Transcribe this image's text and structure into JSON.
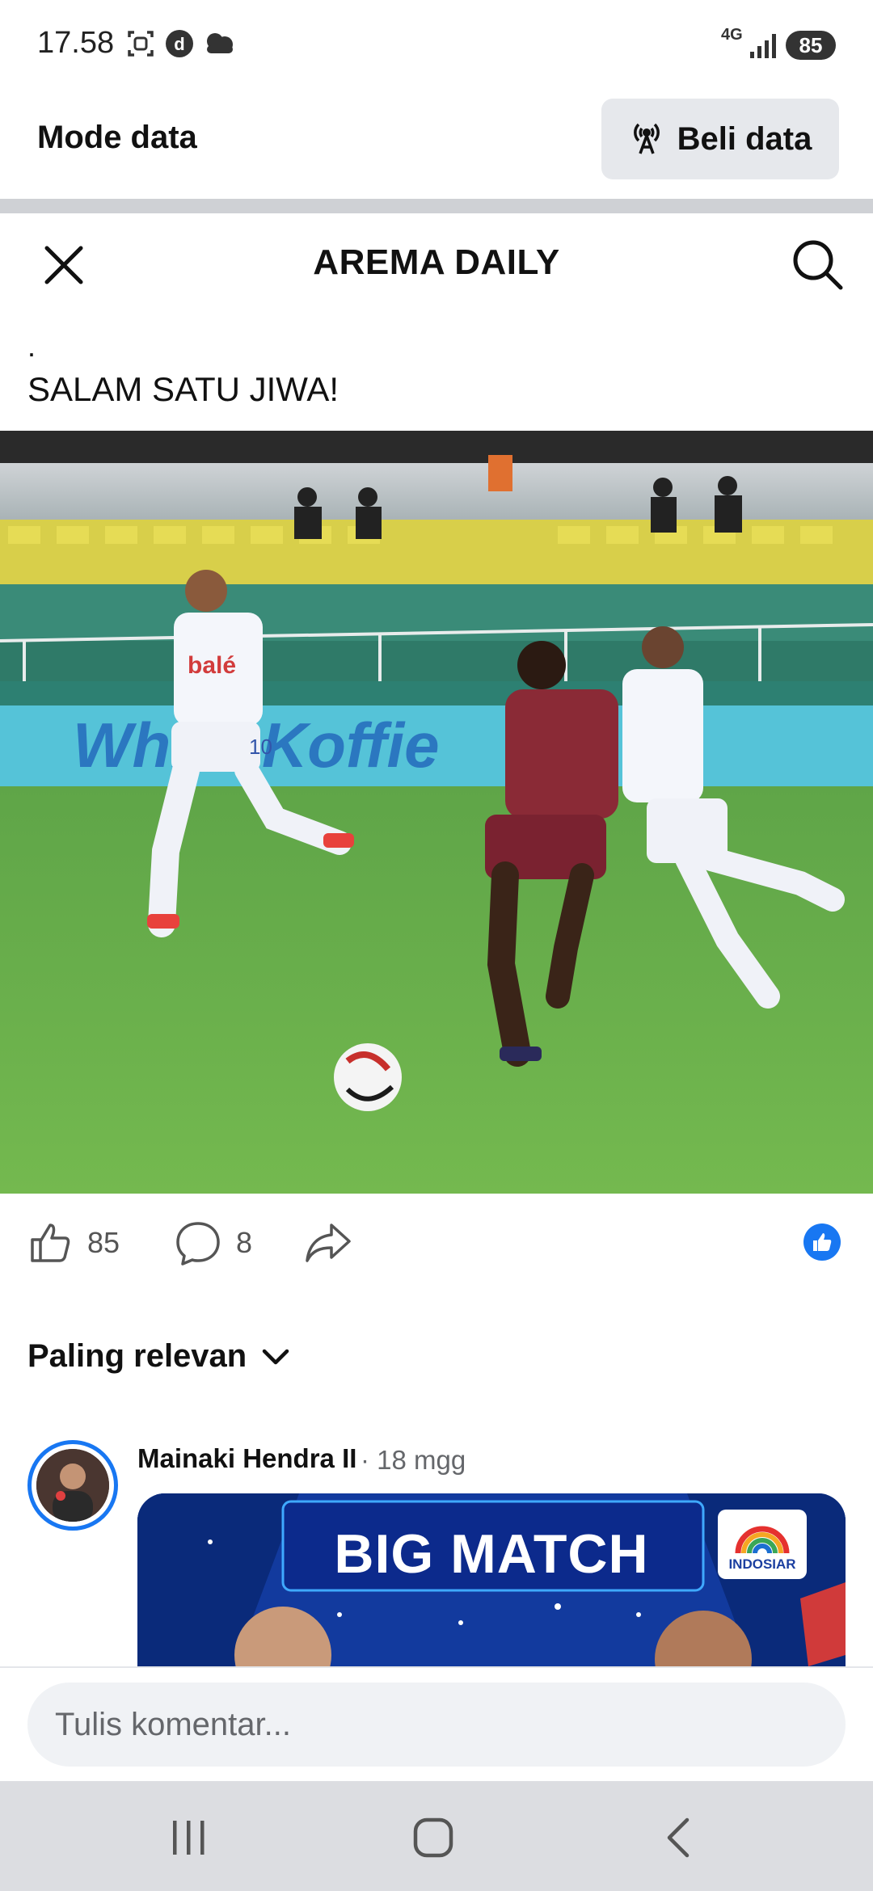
{
  "status_bar": {
    "time": "17.58",
    "network": "4G",
    "battery": "85",
    "icons": [
      "screenshot-icon",
      "d-app-icon",
      "cloud-icon",
      "signal-icon"
    ]
  },
  "data_mode": {
    "label": "Mode data",
    "buy_label": "Beli data",
    "buy_icon": "broadcast-tower-icon"
  },
  "header": {
    "title": "AREMA DAILY",
    "close_icon": "close-icon",
    "search_icon": "search-icon"
  },
  "post": {
    "caption_dot": ".",
    "caption": "SALAM SATU JIWA!",
    "image_sponsor_text": "White Koffie",
    "player_sponsor": "balé",
    "player_number": "10"
  },
  "reactions": {
    "like_count": "85",
    "comment_count": "8",
    "like_color": "#1877f2"
  },
  "sort": {
    "label": "Paling relevan"
  },
  "comment": {
    "author": "Mainaki Hendra II",
    "time": "· 18 mgg",
    "image_title": "BIG MATCH",
    "image_logo": "INDOSIAR"
  },
  "input": {
    "placeholder": "Tulis komentar..."
  },
  "nav": {
    "recent_icon": "recent-apps-icon",
    "home_icon": "home-icon",
    "back_icon": "back-icon"
  }
}
